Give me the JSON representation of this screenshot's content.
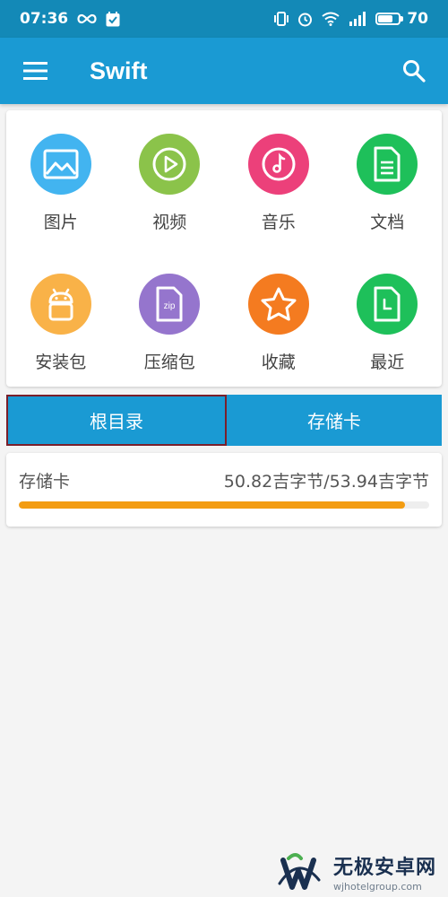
{
  "status_bar": {
    "time": "07:36",
    "battery": "70",
    "battery_level": 0.7
  },
  "app_bar": {
    "title": "Swift",
    "menu_icon": "hamburger-menu-icon",
    "search_icon": "search-icon"
  },
  "categories": [
    {
      "label": "图片",
      "icon": "image-icon",
      "color": "#42b4f0"
    },
    {
      "label": "视频",
      "icon": "play-icon",
      "color": "#8bc34a"
    },
    {
      "label": "音乐",
      "icon": "music-note-icon",
      "color": "#ec407a"
    },
    {
      "label": "文档",
      "icon": "document-icon",
      "color": "#1ec05a"
    },
    {
      "label": "安装包",
      "icon": "android-icon",
      "color": "#f9b248"
    },
    {
      "label": "压缩包",
      "icon": "zip-file-icon",
      "color": "#9575cd"
    },
    {
      "label": "收藏",
      "icon": "star-icon",
      "color": "#f47b20"
    },
    {
      "label": "最近",
      "icon": "recent-file-icon",
      "color": "#1ec05a"
    }
  ],
  "zip_badge": "zip",
  "tabs": {
    "root": "根目录",
    "sdcard": "存储卡"
  },
  "storage": {
    "name": "存储卡",
    "size": "50.82吉字节/53.94吉字节",
    "used_fraction": 0.942,
    "bar_color": "#f39c12"
  },
  "watermark": {
    "main": "无极安卓网",
    "sub": "wjhotelgroup.com"
  }
}
